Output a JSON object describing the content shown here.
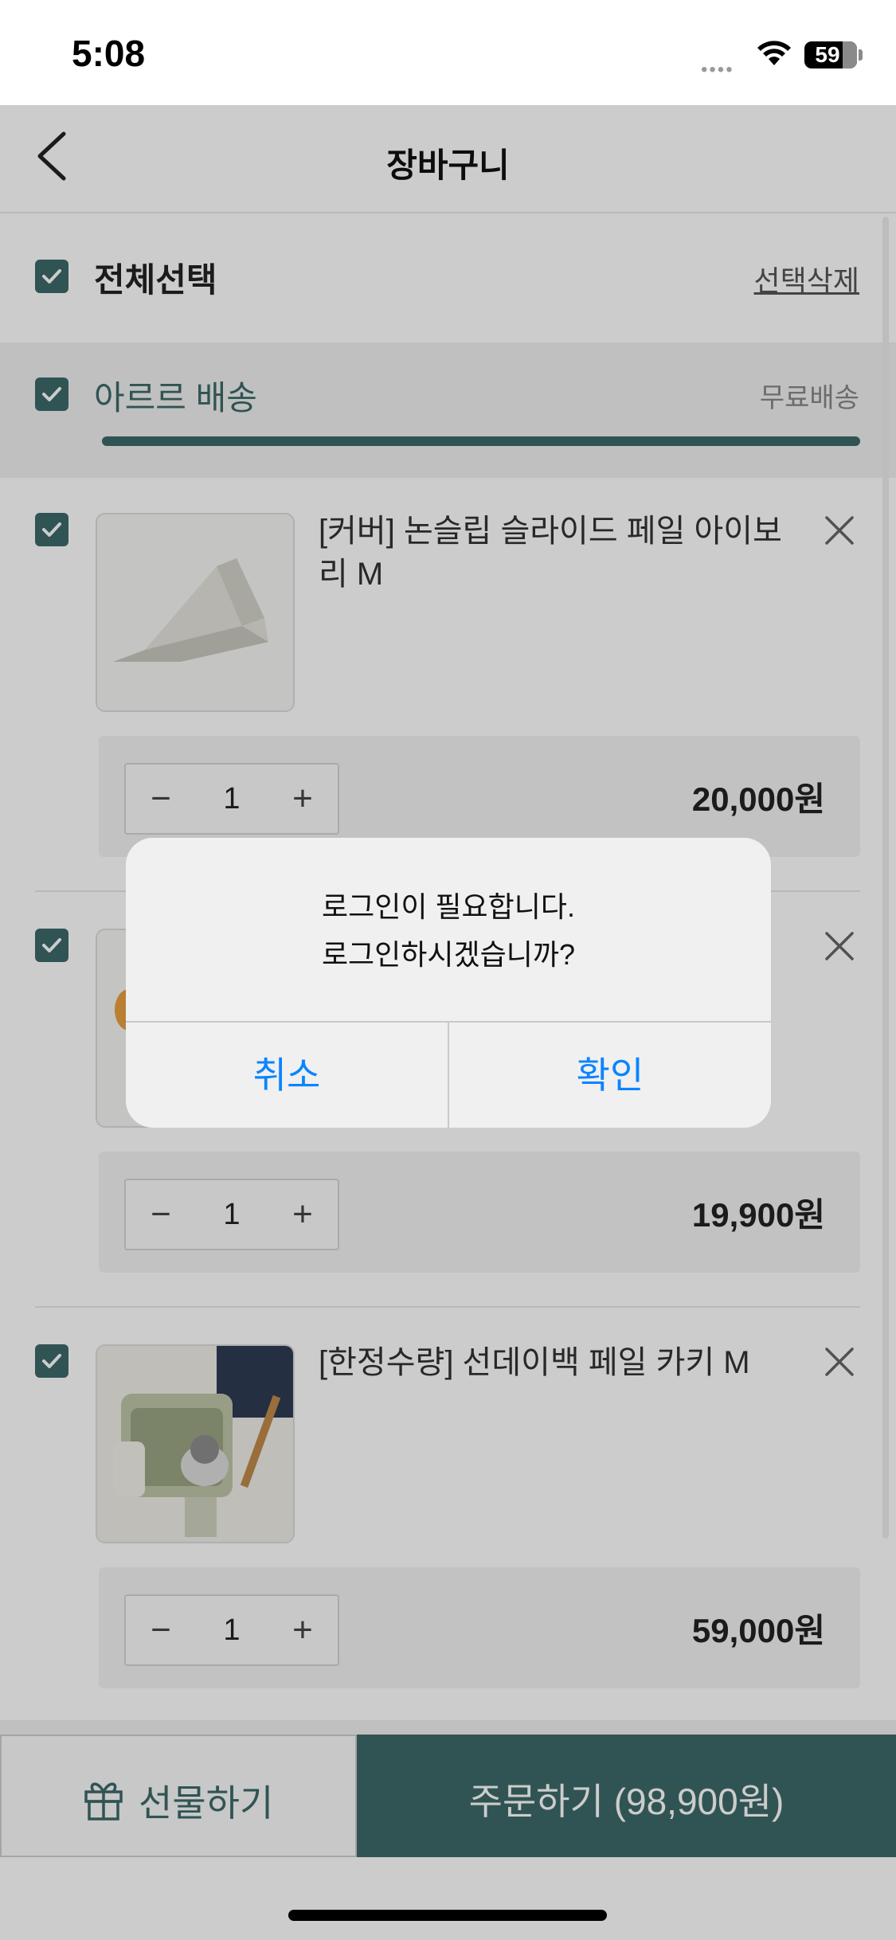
{
  "status_bar": {
    "time": "5:08",
    "signal": "••••",
    "battery": "59"
  },
  "header": {
    "title": "장바구니"
  },
  "select_all": {
    "label": "전체선택",
    "delete_selected": "선택삭제"
  },
  "group": {
    "label": "아르르 배송",
    "shipping": "무료배송",
    "shipping_progress": 1.0
  },
  "items": [
    {
      "name": "[커버] 논슬립 슬라이드 페일 아이보리 M",
      "quantity": "1",
      "price": "20,000원"
    },
    {
      "name": "",
      "quantity": "1",
      "price": "19,900원"
    },
    {
      "name": "[한정수량] 선데이백 페일 카키 M",
      "quantity": "1",
      "price": "59,000원"
    }
  ],
  "stepper": {
    "minus": "−",
    "plus": "+"
  },
  "bottom_bar": {
    "gift_label": "선물하기",
    "order_label": "주문하기 (98,900원)"
  },
  "dialog": {
    "message_line1": "로그인이 필요합니다.",
    "message_line2": "로그인하시겠습니까?",
    "cancel": "취소",
    "confirm": "확인"
  },
  "colors": {
    "accent": "#3c6968",
    "dialog_button": "#0a84ff"
  }
}
